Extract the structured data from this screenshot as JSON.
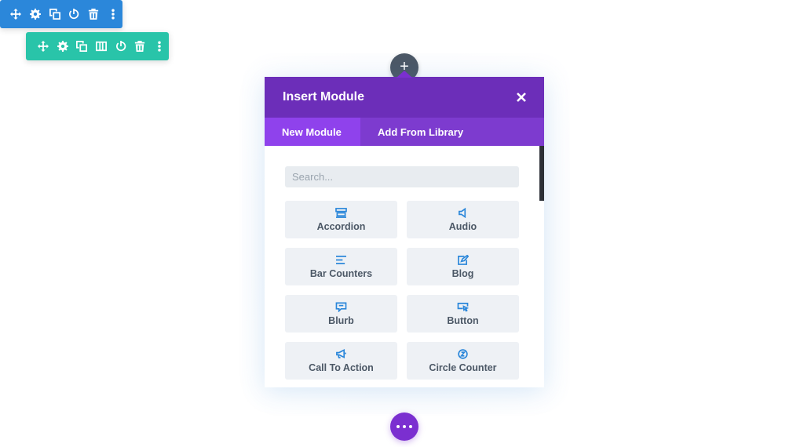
{
  "colors": {
    "section_toolbar": "#2b87da",
    "row_toolbar": "#29c4a9",
    "modal_header": "#6c2eb9",
    "tab_bar": "#7d3bcf",
    "active_tab": "#8f42ec",
    "module_icon": "#2b87da",
    "add_button": "#4c5866",
    "more_button": "#7b2fd0"
  },
  "section_toolbar": {
    "icons": [
      "move-icon",
      "gear-icon",
      "duplicate-icon",
      "power-icon",
      "trash-icon",
      "more-vertical-icon"
    ]
  },
  "row_toolbar": {
    "icons": [
      "move-icon",
      "gear-icon",
      "duplicate-icon",
      "columns-icon",
      "power-icon",
      "trash-icon",
      "more-vertical-icon"
    ]
  },
  "add_button": {
    "label": "+"
  },
  "modal": {
    "title": "Insert Module",
    "tabs": [
      {
        "label": "New Module",
        "active": true
      },
      {
        "label": "Add From Library",
        "active": false
      }
    ],
    "search": {
      "placeholder": "Search...",
      "value": ""
    },
    "modules": [
      {
        "label": "Accordion",
        "icon": "accordion-icon"
      },
      {
        "label": "Audio",
        "icon": "audio-icon"
      },
      {
        "label": "Bar Counters",
        "icon": "bar-counters-icon"
      },
      {
        "label": "Blog",
        "icon": "blog-icon"
      },
      {
        "label": "Blurb",
        "icon": "blurb-icon"
      },
      {
        "label": "Button",
        "icon": "button-icon"
      },
      {
        "label": "Call To Action",
        "icon": "call-to-action-icon"
      },
      {
        "label": "Circle Counter",
        "icon": "circle-counter-icon"
      }
    ]
  }
}
